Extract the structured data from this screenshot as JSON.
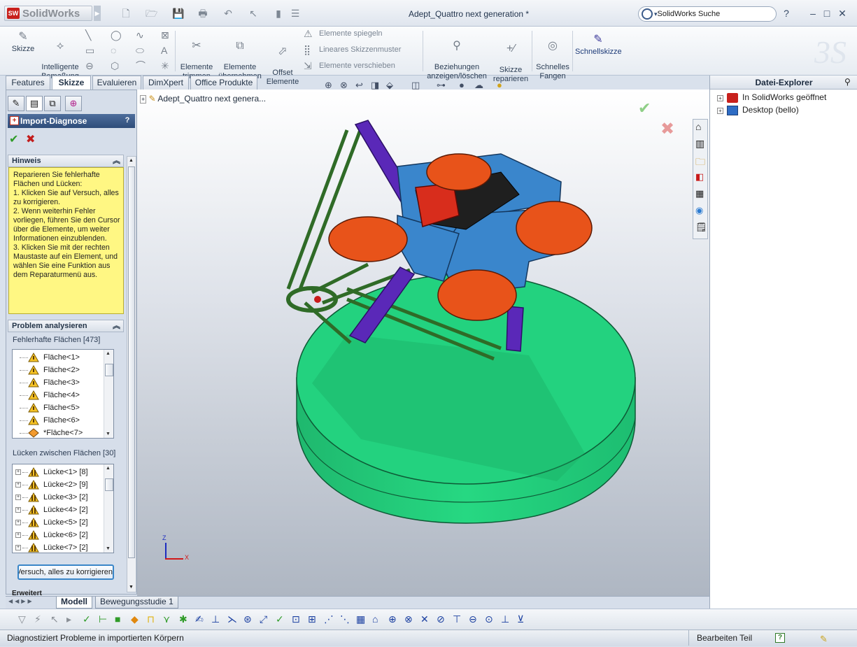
{
  "app": {
    "name": "SolidWorks",
    "logo_text": "SW",
    "document_title": "Adept_Quattro next generation *"
  },
  "search": {
    "placeholder": "SolidWorks Suche"
  },
  "window": {
    "help_label": "?",
    "min_label": "–",
    "max_label": "□",
    "close_label": "✕"
  },
  "ribbon": {
    "skizze": "Skizze",
    "intelligente_bemassung": "Intelligente\nBemaßung",
    "elemente_trimmen": "Elemente\ntrimmen",
    "elemente_uebernehmen": "Elemente\nübernehmen",
    "offset_elemente": "Offset\nElemente",
    "elemente_spiegeln": "Elemente spiegeln",
    "lineares_skizzenmuster": "Lineares Skizzenmuster",
    "elemente_verschieben": "Elemente verschieben",
    "beziehungen": "Beziehungen\nanzeigen/löschen",
    "skizze_reparieren": "Skizze\nreparieren",
    "schnelles_fangen": "Schnelles\nFangen",
    "schnellskizze": "Schnellskizze"
  },
  "tabs": [
    "Features",
    "Skizze",
    "Evaluieren",
    "DimXpert",
    "Office Produkte"
  ],
  "active_tab": "Skizze",
  "property_manager": {
    "title": "Import-Diagnose",
    "help": "?",
    "hint_header": "Hinweis",
    "hint_text": "Reparieren Sie fehlerhafte Flächen und Lücken:\n 1. Klicken Sie auf Versuch, alles zu korrigieren.\n 2. Wenn weiterhin Fehler vorliegen, führen Sie den Cursor über die Elemente, um weiter Informationen einzublenden.\n 3. Klicken Sie mit der rechten Maustaste auf ein Element, und wählen Sie eine Funktion aus dem Reparaturmenü aus.",
    "problem_header": "Problem analysieren",
    "faces_label": "Fehlerhafte Flächen [473]",
    "faces": [
      "Fläche<1>",
      "Fläche<2>",
      "Fläche<3>",
      "Fläche<4>",
      "Fläche<5>",
      "Fläche<6>",
      "*Fläche<7>"
    ],
    "gaps_label": "Lücken zwischen Flächen [30]",
    "gaps": [
      "Lücke<1>  [8]",
      "Lücke<2>  [9]",
      "Lücke<3>  [2]",
      "Lücke<4>  [2]",
      "Lücke<5>  [2]",
      "Lücke<6>  [2]",
      "Lücke<7>  [2]"
    ],
    "fix_button": "Versuch, alles zu korrigieren",
    "advanced_header": "Erweitert"
  },
  "graphics": {
    "tree_root": "Adept_Quattro next genera...",
    "axis_x": "X",
    "axis_y": "Y",
    "axis_z": "Z"
  },
  "file_explorer": {
    "title": "Datei-Explorer",
    "items": [
      "In SolidWorks geöffnet",
      "Desktop (bello)"
    ]
  },
  "bottom_tabs": [
    "Modell",
    "Bewegungsstudie 1"
  ],
  "status": {
    "message": "Diagnostiziert Probleme in importierten Körpern",
    "mode": "Bearbeiten Teil",
    "help_icon": "?"
  },
  "colors": {
    "green_base": "#22d07f",
    "orange_motor": "#e8531a",
    "blue_frame": "#3a86cc",
    "purple_arm": "#5a28b8",
    "dark_green_rod": "#2f6b27",
    "hint_yellow": "#fff783"
  }
}
